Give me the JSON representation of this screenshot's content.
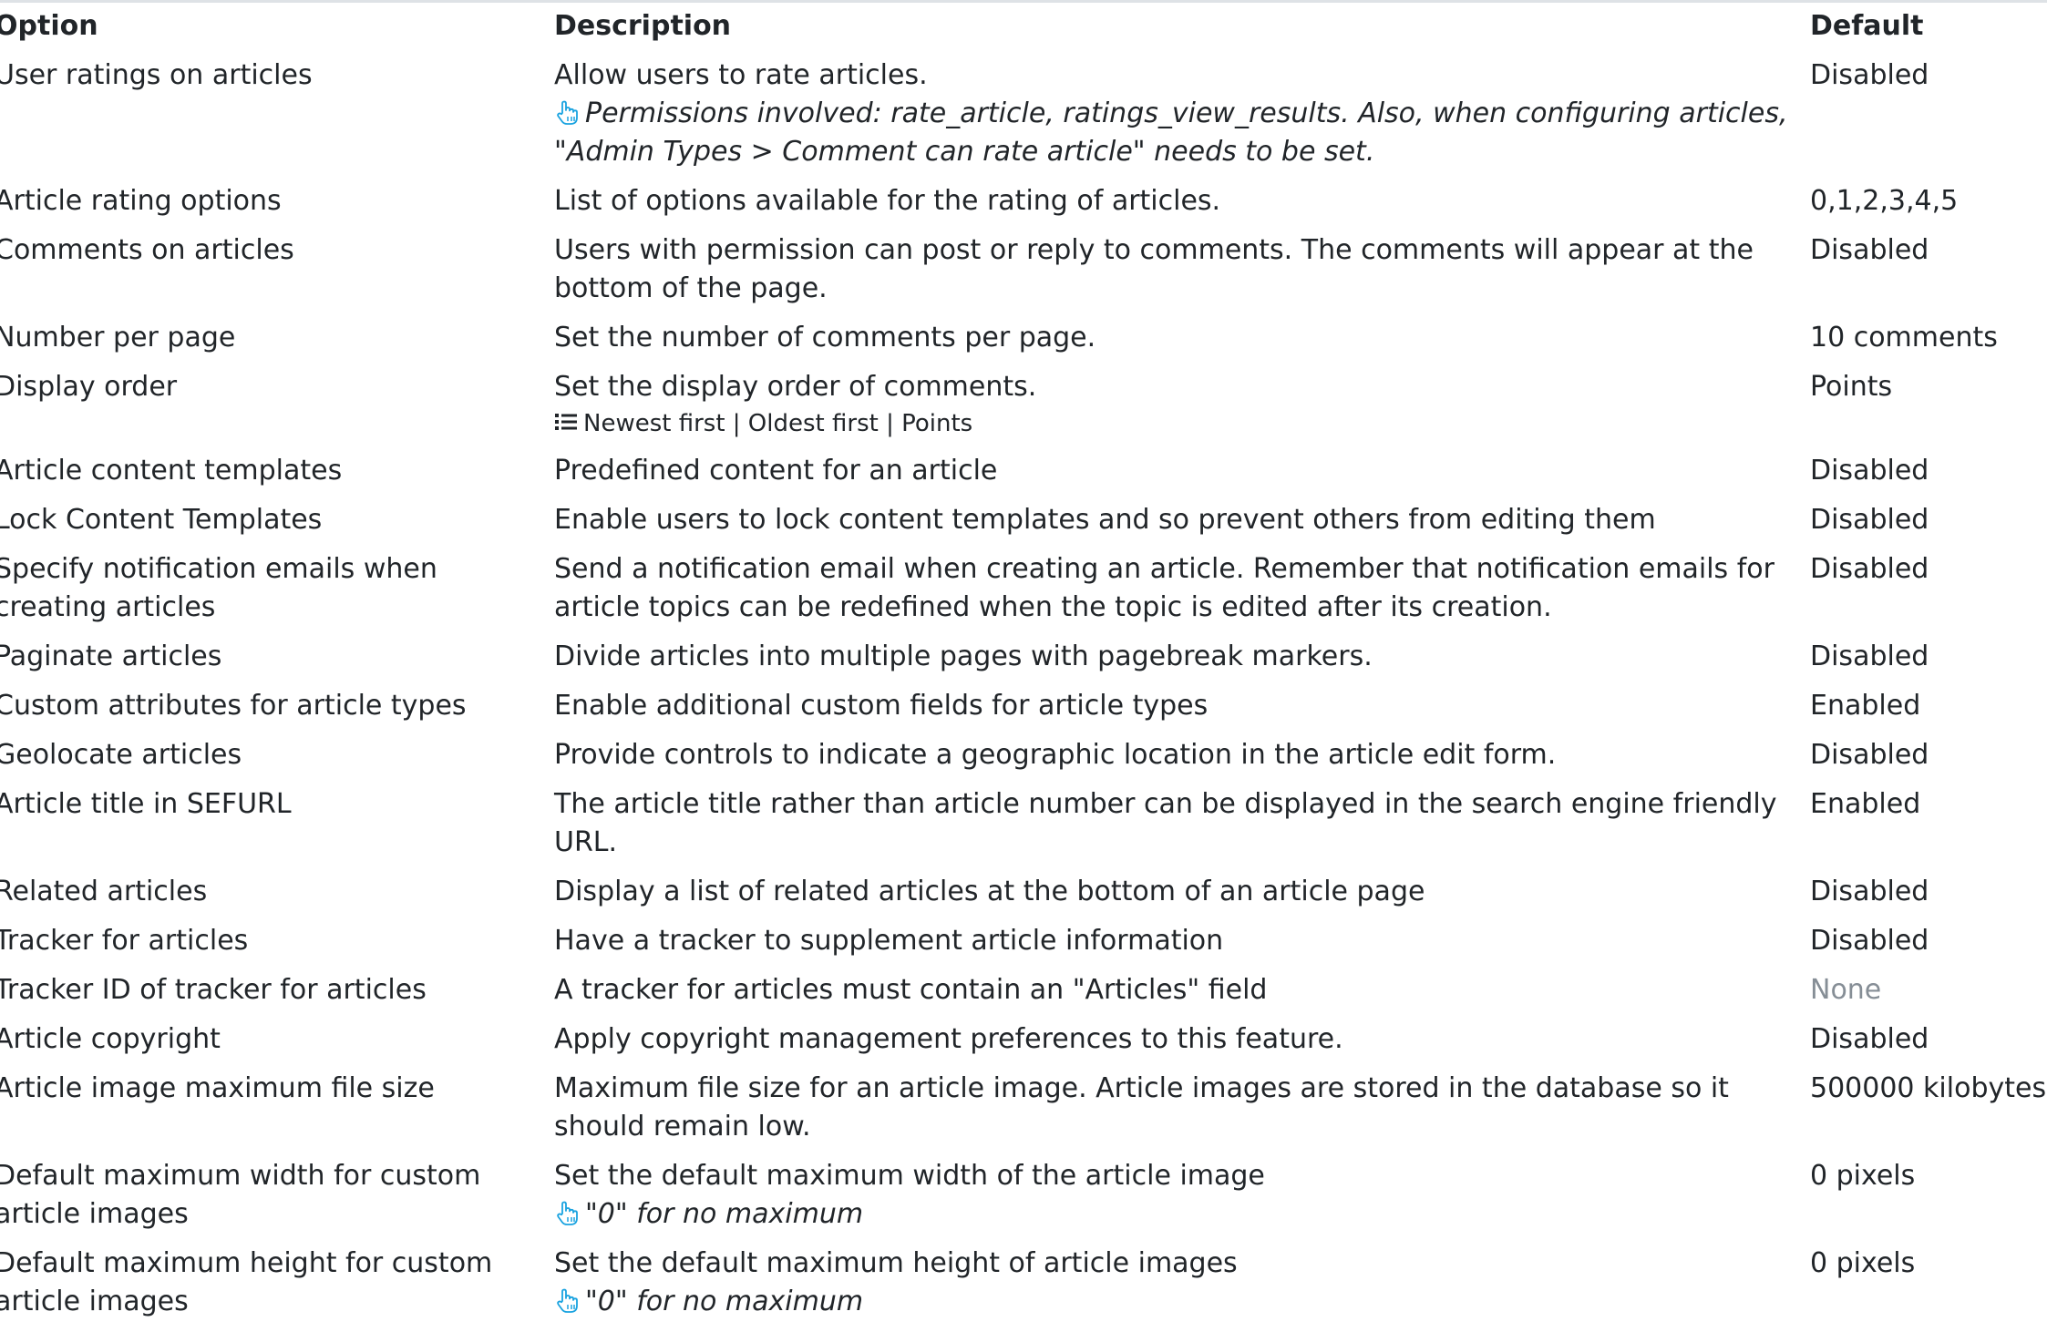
{
  "headers": {
    "option": "Option",
    "description": "Description",
    "default": "Default"
  },
  "rows": [
    {
      "option": "User ratings on articles",
      "description": "Allow users to rate articles.",
      "hint": "Permissions involved: rate_article, ratings_view_results. Also, when configuring articles, \"Admin Types > Comment can rate article\" needs to be set.",
      "default": "Disabled"
    },
    {
      "option": "Article rating options",
      "description": "List of options available for the rating of articles.",
      "default": "0,1,2,3,4,5"
    },
    {
      "option": "Comments on articles",
      "description": "Users with permission can post or reply to comments. The comments will appear at the bottom of the page.",
      "default": "Disabled"
    },
    {
      "option": "Number per page",
      "description": "Set the number of comments per page.",
      "default": "10 comments"
    },
    {
      "option": "Display order",
      "description": "Set the display order of comments.",
      "options_list": "Newest first | Oldest first | Points",
      "default": "Points"
    },
    {
      "option": "Article content templates",
      "description": "Predefined content for an article",
      "default": "Disabled"
    },
    {
      "option": "Lock Content Templates",
      "description": "Enable users to lock content templates and so prevent others from editing them",
      "default": "Disabled"
    },
    {
      "option": "Specify notification emails when creating articles",
      "description": "Send a notification email when creating an article. Remember that notification emails for article topics can be redefined when the topic is edited after its creation.",
      "default": "Disabled"
    },
    {
      "option": "Paginate articles",
      "description": "Divide articles into multiple pages with pagebreak markers.",
      "default": "Disabled"
    },
    {
      "option": "Custom attributes for article types",
      "description": "Enable additional custom fields for article types",
      "default": "Enabled"
    },
    {
      "option": "Geolocate articles",
      "description": "Provide controls to indicate a geographic location in the article edit form.",
      "default": "Disabled"
    },
    {
      "option": "Article title in SEFURL",
      "description": "The article title rather than article number can be displayed in the search engine friendly URL.",
      "default": "Enabled"
    },
    {
      "option": "Related articles",
      "description": "Display a list of related articles at the bottom of an article page",
      "default": "Disabled"
    },
    {
      "option": "Tracker for articles",
      "description": "Have a tracker to supplement article information",
      "default": "Disabled"
    },
    {
      "option": "Tracker ID of tracker for articles",
      "description": "A tracker for articles must contain an \"Articles\" field",
      "default": "None"
    },
    {
      "option": "Article copyright",
      "description": "Apply copyright management preferences to this feature.",
      "default": "Disabled"
    },
    {
      "option": "Article image maximum file size",
      "description": "Maximum file size for an article image. Article images are stored in the database so it should remain low.",
      "default": "500000 kilobytes"
    },
    {
      "option": "Default maximum width for custom article images",
      "description": "Set the default maximum width of the article image",
      "hint": "\"0\" for no maximum",
      "default": "0 pixels"
    },
    {
      "option": "Default maximum height for custom article images",
      "description": "Set the default maximum height of article images",
      "hint": "\"0\" for no maximum",
      "default": "0 pixels"
    }
  ],
  "colors": {
    "text": "#212529",
    "muted": "#868e96",
    "hint_icon": "#1aa3e0",
    "rule": "#dee2e6"
  }
}
